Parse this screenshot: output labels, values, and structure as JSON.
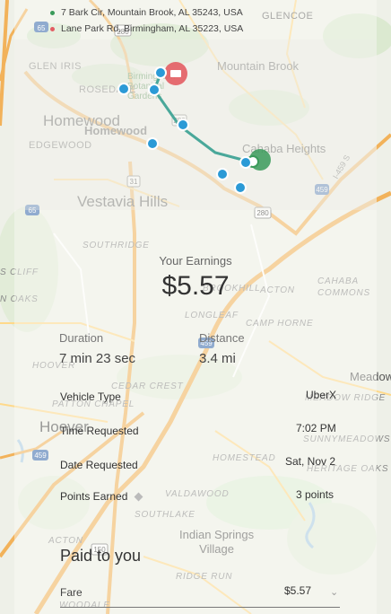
{
  "map": {
    "labels": {
      "glencoe": "GLENCOE",
      "glen_iris": "GLEN IRIS",
      "mountain_brook": "Mountain Brook",
      "rosedale": "ROSEDALE",
      "birmingham_botanical": "Birmingham Botanical Gardens",
      "homewood_big": "Homewood",
      "homewood_small": "Homewood",
      "edgewood": "EDGEWOOD",
      "cahaba_heights": "Cahaba Heights",
      "vestavia_hills": "Vestavia Hills",
      "southridge": "SOUTHRIDGE",
      "cliff": "S CLIFF",
      "oaks": "N OAKS",
      "brookhill": "BROOKHILL",
      "acton_top": "ACTON",
      "cahaba_commons": "CAHABA\nCOMMONS",
      "longleaf": "LONGLEAF",
      "camp_horne": "CAMP HORNE",
      "hoover_small": "HOOVER",
      "cedar_crest": "CEDAR CREST",
      "patton_chapel": "PATTON CHAPEL",
      "meadow": "Meadow",
      "meadow_ridge": "MEADOW RIDGE",
      "hoover_big": "Hoover",
      "sunnymeadows": "SUNNYMEADOWS",
      "homestead": "HOMESTEAD",
      "heritage_oaks": "HERITAGE OAKS",
      "valdawood": "VALDAWOOD",
      "southlake": "SOUTHLAKE",
      "acton_bottom": "ACTON",
      "indian_springs": "Indian Springs\nVillage",
      "ridge_run": "RIDGE RUN",
      "woodale": "WOODALE",
      "hwy_65": "65",
      "hwy_280_top": "280",
      "hwy_31": "31",
      "hwy_280_mid": "280",
      "hwy_459": "459",
      "hwy_459_b": "459",
      "hwy_459_c": "459",
      "i_459": "I-459 S",
      "hwy_150": "150",
      "hwy_65_b": "65"
    },
    "colors": {
      "route": "#4aa89a",
      "waypoint": "#2b9ad6",
      "start_pin": "#e35d63",
      "end_pin": "#3a9a5a"
    }
  },
  "trip": {
    "start_address": "7 Bark Cir, Mountain Brook, AL 35243, USA",
    "end_address": "Lane Park Rd, Birmingham, AL 35223, USA",
    "start_color": "#3a9a5a",
    "end_color": "#e35d63"
  },
  "earnings": {
    "label": "Your Earnings",
    "amount": "$5.57"
  },
  "stats": {
    "duration_label": "Duration",
    "duration_value": "7 min 23 sec",
    "distance_label": "Distance",
    "distance_value": "3.4 mi"
  },
  "details": [
    {
      "label": "Vehicle Type",
      "value": "UberX"
    },
    {
      "label": "Time Requested",
      "value": "7:02 PM"
    },
    {
      "label": "Date Requested",
      "value": "Sat, Nov 2"
    },
    {
      "label": "Points Earned",
      "value": "3 points"
    }
  ],
  "payment": {
    "title": "Paid to you",
    "fare_label": "Fare",
    "fare_value": "$5.57",
    "expand_icon": "chevron-down-icon"
  }
}
